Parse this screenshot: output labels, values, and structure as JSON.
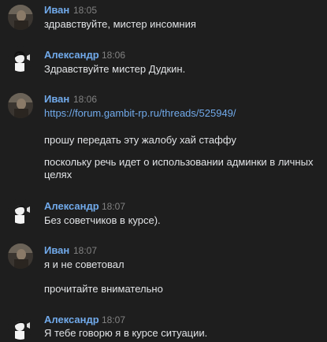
{
  "messages": [
    {
      "author": "Иван",
      "time": "18:05",
      "lines": [
        "здравствуйте, мистер инсомния"
      ]
    },
    {
      "author": "Александр",
      "time": "18:06",
      "lines": [
        "Здравствуйте мистер Дудкин."
      ]
    },
    {
      "author": "Иван",
      "time": "18:06",
      "link": "https://forum.gambit-rp.ru/threads/525949/",
      "lines": [
        "прошу передать эту жалобу хай стаффу",
        "поскольку речь идет о использовании админки в личных целях"
      ]
    },
    {
      "author": "Александр",
      "time": "18:07",
      "lines": [
        "Без советчиков в курсе)."
      ]
    },
    {
      "author": "Иван",
      "time": "18:07",
      "lines": [
        "я и не советовал",
        "прочитайте внимательно"
      ]
    },
    {
      "author": "Александр",
      "time": "18:07",
      "lines": [
        "Я тебе говорю я в курсе ситуации."
      ]
    }
  ],
  "colors": {
    "background": "#1e1e1e",
    "author": "#71aaeb",
    "time": "#828282",
    "text": "#e1e3e6",
    "link": "#71aaeb"
  },
  "icons": {
    "ivan_avatar": "user-photo-avatar",
    "alexandr_avatar": "cartoon-character-avatar"
  }
}
